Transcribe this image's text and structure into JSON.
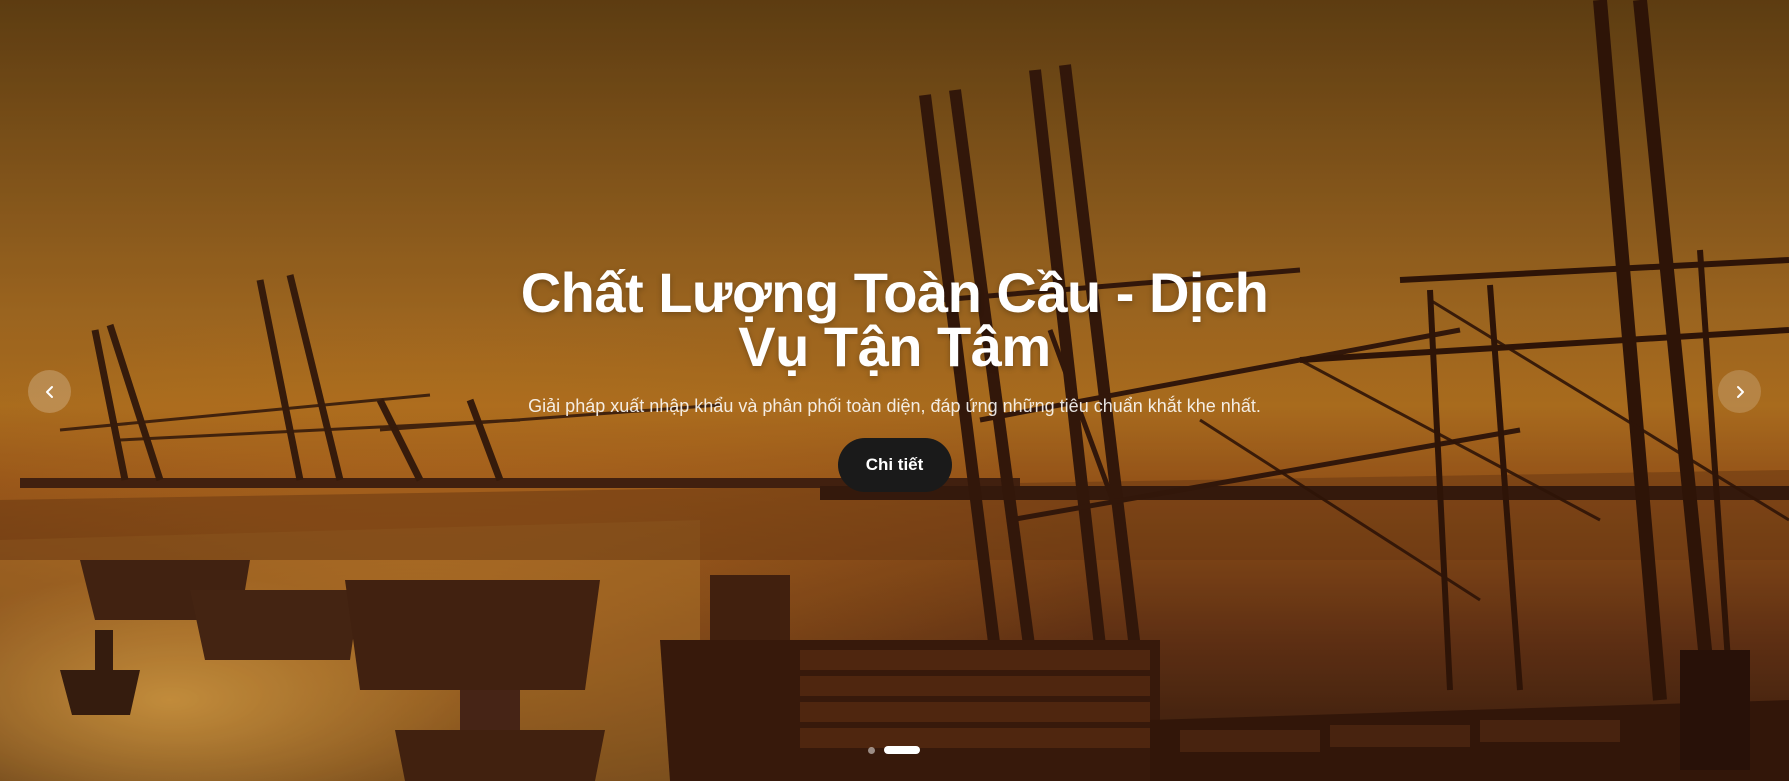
{
  "hero": {
    "title": "Chất Lượng Toàn Cầu - Dịch Vụ Tận Tâm",
    "subtitle": "Giải pháp xuất nhập khẩu và phân phối toàn diện, đáp ứng những tiêu chuẩn khắt khe nhất.",
    "cta_label": "Chi tiết",
    "background_icon": "port-cranes-sunset-image"
  },
  "carousel": {
    "prev_icon": "chevron-left-icon",
    "next_icon": "chevron-right-icon",
    "slide_count": 2,
    "active_slide": 2
  },
  "colors": {
    "accent": "#1a1a1a",
    "text": "#ffffff",
    "sky": "#b07224"
  }
}
